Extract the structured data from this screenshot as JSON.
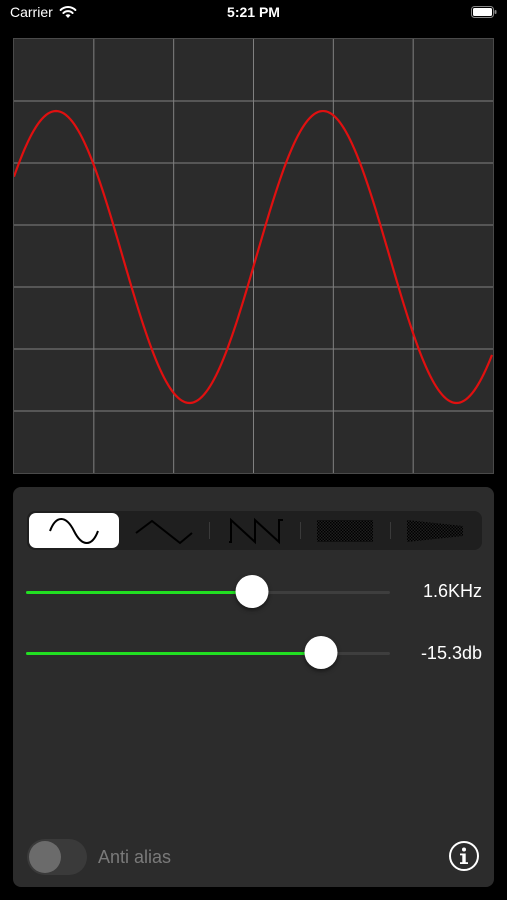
{
  "status_bar": {
    "carrier": "Carrier",
    "time": "5:21 PM",
    "wifi_icon": "wifi-icon",
    "battery_icon": "battery-icon"
  },
  "scope": {
    "trace_color": "#e01010",
    "grid_color": "#808080",
    "background": "#2b2b2b"
  },
  "waveforms": {
    "selected": "sine",
    "items": [
      {
        "id": "sine",
        "icon": "sine-wave-icon"
      },
      {
        "id": "triangle",
        "icon": "triangle-wave-icon"
      },
      {
        "id": "sawtooth",
        "icon": "sawtooth-wave-icon"
      },
      {
        "id": "white-noise",
        "icon": "white-noise-icon"
      },
      {
        "id": "pink-noise",
        "icon": "pink-noise-icon"
      }
    ]
  },
  "frequency": {
    "value_label": "1.6KHz",
    "fraction": 0.62
  },
  "volume": {
    "value_label": "-15.3db",
    "fraction": 0.81
  },
  "anti_alias": {
    "label": "Anti alias",
    "enabled": false
  },
  "info_icon": "info-icon",
  "accent_color": "#22e022"
}
